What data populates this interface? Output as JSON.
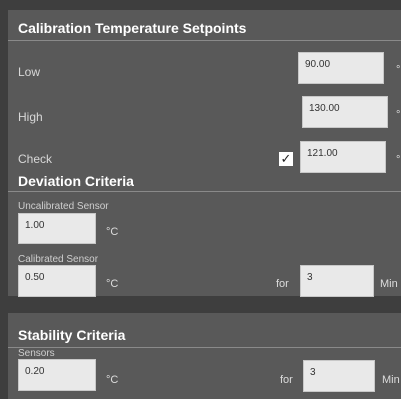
{
  "calibration": {
    "title": "Calibration Temperature Setpoints",
    "low": {
      "label": "Low",
      "value": "90.00",
      "unit": "°"
    },
    "high": {
      "label": "High",
      "value": "130.00",
      "unit": "°"
    },
    "check": {
      "label": "Check",
      "checkmark": "✓",
      "checked": true,
      "value": "121.00",
      "unit": "°"
    }
  },
  "deviation": {
    "title": "Deviation Criteria",
    "uncalibrated": {
      "label": "Uncalibrated Sensor",
      "value": "1.00",
      "unit": "°C"
    },
    "calibrated": {
      "label": "Calibrated Sensor",
      "value": "0.50",
      "unit": "°C",
      "for_label": "for",
      "for_value": "3",
      "trailing": "Min"
    }
  },
  "stability": {
    "title": "Stability Criteria",
    "sensors": {
      "label": "Sensors",
      "value": "0.20",
      "unit": "°C",
      "for_label": "for",
      "for_value": "3",
      "trailing": "Min"
    }
  }
}
